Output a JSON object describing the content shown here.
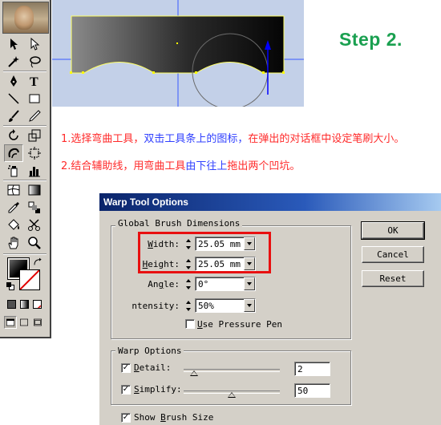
{
  "step": {
    "title": "Step 2."
  },
  "instructions": [
    {
      "segments": [
        {
          "text": "1.选择弯曲工具，",
          "color": "red"
        },
        {
          "text": "双击工具条上的图标，",
          "color": "blue"
        },
        {
          "text": "在弹出的对话框中设定笔刷大小。",
          "color": "red"
        }
      ]
    },
    {
      "segments": [
        {
          "text": "2.结合辅助线，用弯曲工具",
          "color": "red"
        },
        {
          "text": "由下往上",
          "color": "blue"
        },
        {
          "text": "拖出两个凹坑。",
          "color": "red"
        }
      ]
    }
  ],
  "toolbox": {
    "tools": [
      "selection-tool-icon",
      "direct-selection-tool-icon",
      "magic-wand-tool-icon",
      "lasso-tool-icon",
      "pen-tool-icon",
      "type-tool-icon",
      "line-segment-tool-icon",
      "rectangle-tool-icon",
      "paintbrush-tool-icon",
      "pencil-tool-icon",
      "rotate-tool-icon",
      "scale-tool-icon",
      "warp-tool-icon",
      "free-transform-tool-icon",
      "symbol-sprayer-tool-icon",
      "column-graph-tool-icon",
      "mesh-tool-icon",
      "gradient-tool-icon",
      "eyedropper-tool-icon",
      "blend-tool-icon",
      "live-paint-bucket-tool-icon",
      "scissors-tool-icon",
      "hand-tool-icon",
      "zoom-tool-icon"
    ],
    "active_tool": "warp-tool-icon",
    "fill_color": "#000000",
    "stroke_color": "none"
  },
  "dialog": {
    "title": "Warp Tool Options",
    "global_group": "Global Brush Dimensions",
    "width": {
      "label_u": "W",
      "label_rest": "idth:",
      "value": "25.05 mm"
    },
    "height": {
      "label_u": "H",
      "label_rest": "eight:",
      "value": "25.05 mm"
    },
    "angle": {
      "label_pre": "An",
      "label_u": "g",
      "label_rest": "le:",
      "value": "0°"
    },
    "intensity": {
      "label": "ntensity:",
      "value": "50%"
    },
    "use_pressure_pen": {
      "label_u": "U",
      "label_rest": "se Pressure Pen",
      "checked": false
    },
    "buttons": {
      "ok": "OK",
      "cancel": "Cancel",
      "reset": "Reset"
    },
    "warp_group": "Warp Options",
    "detail": {
      "label_u": "D",
      "label_rest": "etail:",
      "checked": true,
      "slider_value": 2,
      "value": "2"
    },
    "simplify": {
      "label_u": "S",
      "label_rest": "implify:",
      "checked": true,
      "slider_value": 50,
      "value": "50"
    },
    "show_brush_size": {
      "label_pre": "Show ",
      "label_u": "B",
      "label_rest": "rush Size",
      "checked": true
    }
  },
  "colors": {
    "step_green": "#1aa050",
    "instruction_red": "#ff2a2a",
    "instruction_blue": "#3040ff",
    "highlight": "#e81010",
    "titlebar": "#0a246a"
  }
}
